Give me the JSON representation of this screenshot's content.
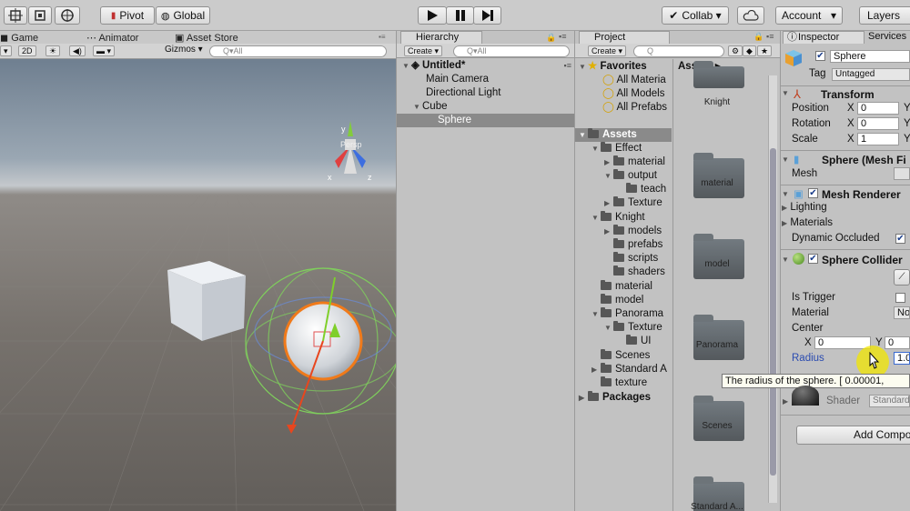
{
  "toolbar": {
    "pivot_label": "Pivot",
    "global_label": "Global",
    "collab_label": "Collab ▾",
    "account_label": "Account",
    "layers_label": "Layers",
    "account_caret": "▾"
  },
  "scene": {
    "tabs": [
      "Game",
      "Animator",
      "Asset Store"
    ],
    "mode_2d": "2D",
    "gizmos_label": "Gizmos ▾",
    "search_placeholder": "Q▾All",
    "persp_label": "Persp"
  },
  "hierarchy": {
    "tab_label": "Hierarchy",
    "create_label": "Create ▾",
    "search_placeholder": "Q▾All",
    "scene_name": "Untitled*",
    "items": [
      "Main Camera",
      "Directional Light",
      "Cube",
      "Sphere"
    ]
  },
  "project": {
    "tab_label": "Project",
    "create_label": "Create ▾",
    "favorites_label": "Favorites",
    "favorites": [
      "All Materia",
      "All Models",
      "All Prefabs"
    ],
    "breadcrumb": "Assets ▸",
    "tree": [
      "Assets",
      "Effect",
      "material",
      "output",
      "teach",
      "Texture",
      "Knight",
      "models",
      "prefabs",
      "scripts",
      "shaders",
      "material",
      "model",
      "Panorama",
      "Texture",
      "UI",
      "Scenes",
      "Standard A",
      "texture",
      "Packages"
    ],
    "grid": [
      "Knight",
      "material",
      "model",
      "Panorama",
      "Scenes",
      "Standard A..."
    ]
  },
  "inspector": {
    "tab_label": "Inspector",
    "services_label": "Services",
    "object_name": "Sphere",
    "tag_label": "Tag",
    "tag_value": "Untagged",
    "transform": {
      "title": "Transform",
      "position_label": "Position",
      "rotation_label": "Rotation",
      "scale_label": "Scale",
      "x_axis": "X",
      "y_axis": "Y",
      "position_x": "0",
      "rotation_x": "0",
      "scale_x": "1"
    },
    "mesh_filter": {
      "title": "Sphere (Mesh Fi",
      "mesh_label": "Mesh"
    },
    "mesh_renderer": {
      "title": "Mesh Renderer",
      "lighting": "Lighting",
      "materials": "Materials",
      "dynamic_occluded": "Dynamic Occluded"
    },
    "collider": {
      "title": "Sphere Collider",
      "is_trigger": "Is Trigger",
      "material": "Material",
      "material_value": "No",
      "center": "Center",
      "center_x_label": "X",
      "center_x": "0",
      "center_y_label": "Y",
      "center_y": "0",
      "radius": "Radius",
      "radius_value": "1.0"
    },
    "tooltip": "The radius of the sphere. [ 0.00001,",
    "shader_label": "Shader",
    "shader_value": "Standard",
    "add_component": "Add Compo"
  },
  "colors": {
    "accent_blue": "#2a4bb0",
    "selection": "#8a8a8a",
    "highlight_yellow": "#f2e600",
    "orange_outline": "#f07a1a"
  }
}
